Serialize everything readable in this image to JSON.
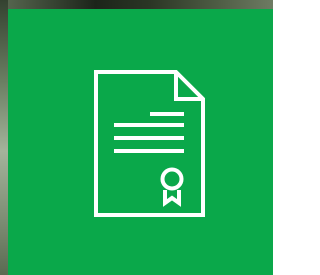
{
  "tile": {
    "background_color": "#0aa84a",
    "icon": "certificate-document-icon",
    "icon_color": "#ffffff"
  }
}
